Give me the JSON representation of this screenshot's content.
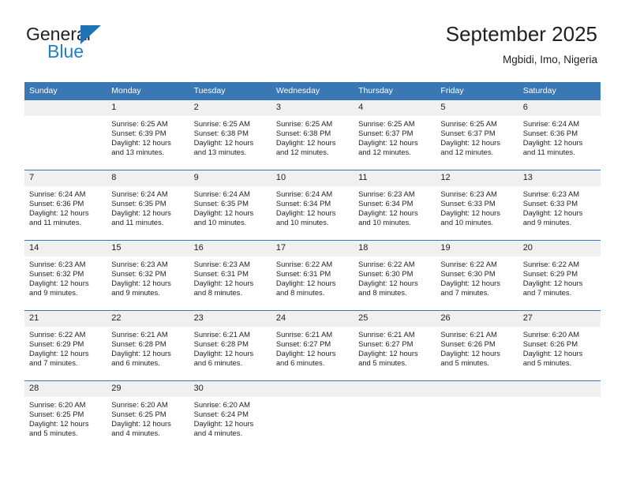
{
  "brand": {
    "name_part1": "General",
    "name_part2": "Blue",
    "flag_icon": "blue-triangle-flag-icon"
  },
  "header": {
    "title": "September 2025",
    "location": "Mgbidi, Imo, Nigeria"
  },
  "calendar": {
    "weekday_headers": [
      "Sunday",
      "Monday",
      "Tuesday",
      "Wednesday",
      "Thursday",
      "Friday",
      "Saturday"
    ],
    "accent_color": "#3a77b5",
    "daynum_band_color": "#f0f0f0",
    "weeks": [
      [
        {
          "day": "",
          "sunrise": "",
          "sunset": "",
          "daylight_line1": "",
          "daylight_line2": ""
        },
        {
          "day": "1",
          "sunrise": "Sunrise: 6:25 AM",
          "sunset": "Sunset: 6:39 PM",
          "daylight_line1": "Daylight: 12 hours",
          "daylight_line2": "and 13 minutes."
        },
        {
          "day": "2",
          "sunrise": "Sunrise: 6:25 AM",
          "sunset": "Sunset: 6:38 PM",
          "daylight_line1": "Daylight: 12 hours",
          "daylight_line2": "and 13 minutes."
        },
        {
          "day": "3",
          "sunrise": "Sunrise: 6:25 AM",
          "sunset": "Sunset: 6:38 PM",
          "daylight_line1": "Daylight: 12 hours",
          "daylight_line2": "and 12 minutes."
        },
        {
          "day": "4",
          "sunrise": "Sunrise: 6:25 AM",
          "sunset": "Sunset: 6:37 PM",
          "daylight_line1": "Daylight: 12 hours",
          "daylight_line2": "and 12 minutes."
        },
        {
          "day": "5",
          "sunrise": "Sunrise: 6:25 AM",
          "sunset": "Sunset: 6:37 PM",
          "daylight_line1": "Daylight: 12 hours",
          "daylight_line2": "and 12 minutes."
        },
        {
          "day": "6",
          "sunrise": "Sunrise: 6:24 AM",
          "sunset": "Sunset: 6:36 PM",
          "daylight_line1": "Daylight: 12 hours",
          "daylight_line2": "and 11 minutes."
        }
      ],
      [
        {
          "day": "7",
          "sunrise": "Sunrise: 6:24 AM",
          "sunset": "Sunset: 6:36 PM",
          "daylight_line1": "Daylight: 12 hours",
          "daylight_line2": "and 11 minutes."
        },
        {
          "day": "8",
          "sunrise": "Sunrise: 6:24 AM",
          "sunset": "Sunset: 6:35 PM",
          "daylight_line1": "Daylight: 12 hours",
          "daylight_line2": "and 11 minutes."
        },
        {
          "day": "9",
          "sunrise": "Sunrise: 6:24 AM",
          "sunset": "Sunset: 6:35 PM",
          "daylight_line1": "Daylight: 12 hours",
          "daylight_line2": "and 10 minutes."
        },
        {
          "day": "10",
          "sunrise": "Sunrise: 6:24 AM",
          "sunset": "Sunset: 6:34 PM",
          "daylight_line1": "Daylight: 12 hours",
          "daylight_line2": "and 10 minutes."
        },
        {
          "day": "11",
          "sunrise": "Sunrise: 6:23 AM",
          "sunset": "Sunset: 6:34 PM",
          "daylight_line1": "Daylight: 12 hours",
          "daylight_line2": "and 10 minutes."
        },
        {
          "day": "12",
          "sunrise": "Sunrise: 6:23 AM",
          "sunset": "Sunset: 6:33 PM",
          "daylight_line1": "Daylight: 12 hours",
          "daylight_line2": "and 10 minutes."
        },
        {
          "day": "13",
          "sunrise": "Sunrise: 6:23 AM",
          "sunset": "Sunset: 6:33 PM",
          "daylight_line1": "Daylight: 12 hours",
          "daylight_line2": "and 9 minutes."
        }
      ],
      [
        {
          "day": "14",
          "sunrise": "Sunrise: 6:23 AM",
          "sunset": "Sunset: 6:32 PM",
          "daylight_line1": "Daylight: 12 hours",
          "daylight_line2": "and 9 minutes."
        },
        {
          "day": "15",
          "sunrise": "Sunrise: 6:23 AM",
          "sunset": "Sunset: 6:32 PM",
          "daylight_line1": "Daylight: 12 hours",
          "daylight_line2": "and 9 minutes."
        },
        {
          "day": "16",
          "sunrise": "Sunrise: 6:23 AM",
          "sunset": "Sunset: 6:31 PM",
          "daylight_line1": "Daylight: 12 hours",
          "daylight_line2": "and 8 minutes."
        },
        {
          "day": "17",
          "sunrise": "Sunrise: 6:22 AM",
          "sunset": "Sunset: 6:31 PM",
          "daylight_line1": "Daylight: 12 hours",
          "daylight_line2": "and 8 minutes."
        },
        {
          "day": "18",
          "sunrise": "Sunrise: 6:22 AM",
          "sunset": "Sunset: 6:30 PM",
          "daylight_line1": "Daylight: 12 hours",
          "daylight_line2": "and 8 minutes."
        },
        {
          "day": "19",
          "sunrise": "Sunrise: 6:22 AM",
          "sunset": "Sunset: 6:30 PM",
          "daylight_line1": "Daylight: 12 hours",
          "daylight_line2": "and 7 minutes."
        },
        {
          "day": "20",
          "sunrise": "Sunrise: 6:22 AM",
          "sunset": "Sunset: 6:29 PM",
          "daylight_line1": "Daylight: 12 hours",
          "daylight_line2": "and 7 minutes."
        }
      ],
      [
        {
          "day": "21",
          "sunrise": "Sunrise: 6:22 AM",
          "sunset": "Sunset: 6:29 PM",
          "daylight_line1": "Daylight: 12 hours",
          "daylight_line2": "and 7 minutes."
        },
        {
          "day": "22",
          "sunrise": "Sunrise: 6:21 AM",
          "sunset": "Sunset: 6:28 PM",
          "daylight_line1": "Daylight: 12 hours",
          "daylight_line2": "and 6 minutes."
        },
        {
          "day": "23",
          "sunrise": "Sunrise: 6:21 AM",
          "sunset": "Sunset: 6:28 PM",
          "daylight_line1": "Daylight: 12 hours",
          "daylight_line2": "and 6 minutes."
        },
        {
          "day": "24",
          "sunrise": "Sunrise: 6:21 AM",
          "sunset": "Sunset: 6:27 PM",
          "daylight_line1": "Daylight: 12 hours",
          "daylight_line2": "and 6 minutes."
        },
        {
          "day": "25",
          "sunrise": "Sunrise: 6:21 AM",
          "sunset": "Sunset: 6:27 PM",
          "daylight_line1": "Daylight: 12 hours",
          "daylight_line2": "and 5 minutes."
        },
        {
          "day": "26",
          "sunrise": "Sunrise: 6:21 AM",
          "sunset": "Sunset: 6:26 PM",
          "daylight_line1": "Daylight: 12 hours",
          "daylight_line2": "and 5 minutes."
        },
        {
          "day": "27",
          "sunrise": "Sunrise: 6:20 AM",
          "sunset": "Sunset: 6:26 PM",
          "daylight_line1": "Daylight: 12 hours",
          "daylight_line2": "and 5 minutes."
        }
      ],
      [
        {
          "day": "28",
          "sunrise": "Sunrise: 6:20 AM",
          "sunset": "Sunset: 6:25 PM",
          "daylight_line1": "Daylight: 12 hours",
          "daylight_line2": "and 5 minutes."
        },
        {
          "day": "29",
          "sunrise": "Sunrise: 6:20 AM",
          "sunset": "Sunset: 6:25 PM",
          "daylight_line1": "Daylight: 12 hours",
          "daylight_line2": "and 4 minutes."
        },
        {
          "day": "30",
          "sunrise": "Sunrise: 6:20 AM",
          "sunset": "Sunset: 6:24 PM",
          "daylight_line1": "Daylight: 12 hours",
          "daylight_line2": "and 4 minutes."
        },
        {
          "day": "",
          "sunrise": "",
          "sunset": "",
          "daylight_line1": "",
          "daylight_line2": ""
        },
        {
          "day": "",
          "sunrise": "",
          "sunset": "",
          "daylight_line1": "",
          "daylight_line2": ""
        },
        {
          "day": "",
          "sunrise": "",
          "sunset": "",
          "daylight_line1": "",
          "daylight_line2": ""
        },
        {
          "day": "",
          "sunrise": "",
          "sunset": "",
          "daylight_line1": "",
          "daylight_line2": ""
        }
      ]
    ]
  }
}
